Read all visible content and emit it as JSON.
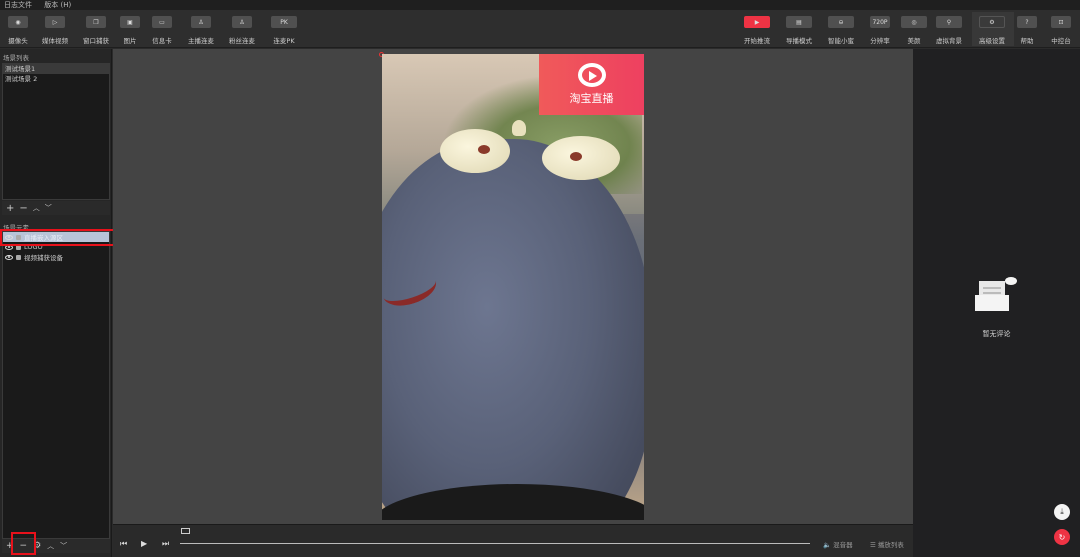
{
  "menu": [
    "日志文件",
    "版本 (H)"
  ],
  "toolbar_left": [
    {
      "label": "摄像头",
      "icon": "camera-icon"
    },
    {
      "label": "媒体视频",
      "icon": "play-icon"
    },
    {
      "label": "窗口捕获",
      "icon": "window-icon"
    },
    {
      "label": "图片",
      "icon": "image-icon"
    },
    {
      "label": "信息卡",
      "icon": "card-icon"
    },
    {
      "label": "主播连麦",
      "icon": "anchor-link-icon"
    },
    {
      "label": "粉丝连麦",
      "icon": "fan-link-icon"
    },
    {
      "label": "连麦PK",
      "icon": "pk-icon",
      "text": "PK"
    }
  ],
  "toolbar_right": [
    {
      "label": "开始推流",
      "icon": "stream-start-icon"
    },
    {
      "label": "导播模式",
      "icon": "director-icon"
    },
    {
      "label": "智能小蜜",
      "icon": "assistant-icon"
    },
    {
      "label": "分辨率",
      "icon": "resolution-icon",
      "text": "720P"
    },
    {
      "label": "美颜",
      "icon": "beauty-icon"
    },
    {
      "label": "虚拟背景",
      "icon": "virtual-bg-icon"
    },
    {
      "label": "高级设置",
      "icon": "settings-icon"
    },
    {
      "label": "帮助",
      "icon": "help-icon"
    },
    {
      "label": "中控台",
      "icon": "console-icon"
    }
  ],
  "scenes": {
    "title": "场景列表",
    "items": [
      "测试场景1",
      "测试场景 2"
    ]
  },
  "sources": {
    "title": "场景元素",
    "items": [
      "直播嵌入源区",
      "LOGO",
      "视频捕获设备"
    ]
  },
  "preview": {
    "logo_text": "淘宝直播"
  },
  "playbar": {
    "mixer": "混音器",
    "playlist": "播放列表"
  },
  "comments": {
    "empty_text": "暂无评论"
  },
  "colors": {
    "accent": "#ee3344",
    "highlight_box": "#e8111b"
  }
}
